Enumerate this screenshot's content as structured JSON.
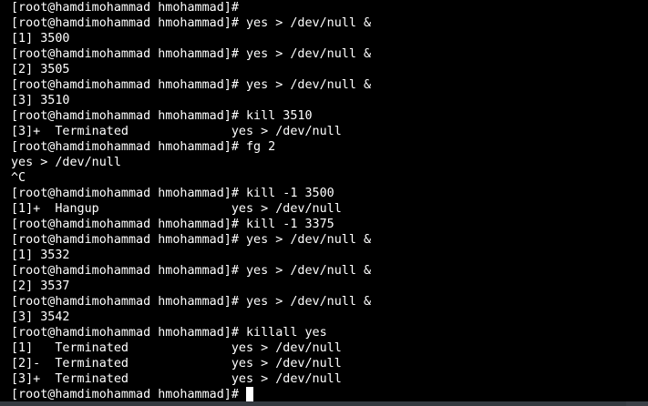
{
  "terminal": {
    "lines": [
      "[root@hamdimohammad hmohammad]#",
      "[root@hamdimohammad hmohammad]# yes > /dev/null &",
      "[1] 3500",
      "[root@hamdimohammad hmohammad]# yes > /dev/null &",
      "[2] 3505",
      "[root@hamdimohammad hmohammad]# yes > /dev/null &",
      "[3] 3510",
      "[root@hamdimohammad hmohammad]# kill 3510",
      "[3]+  Terminated              yes > /dev/null",
      "[root@hamdimohammad hmohammad]# fg 2",
      "yes > /dev/null",
      "^C",
      "[root@hamdimohammad hmohammad]# kill -1 3500",
      "[1]+  Hangup                  yes > /dev/null",
      "[root@hamdimohammad hmohammad]# kill -1 3375",
      "[root@hamdimohammad hmohammad]# yes > /dev/null &",
      "[1] 3532",
      "[root@hamdimohammad hmohammad]# yes > /dev/null &",
      "[2] 3537",
      "[root@hamdimohammad hmohammad]# yes > /dev/null &",
      "[3] 3542",
      "[root@hamdimohammad hmohammad]# killall yes",
      "[1]   Terminated              yes > /dev/null",
      "[2]-  Terminated              yes > /dev/null",
      "[3]+  Terminated              yes > /dev/null",
      "[root@hamdimohammad hmohammad]# "
    ],
    "colors": {
      "background": "#000000",
      "foreground": "#ffffff",
      "cursor": "#ffffff",
      "bottom_strip": "#353a40"
    }
  }
}
